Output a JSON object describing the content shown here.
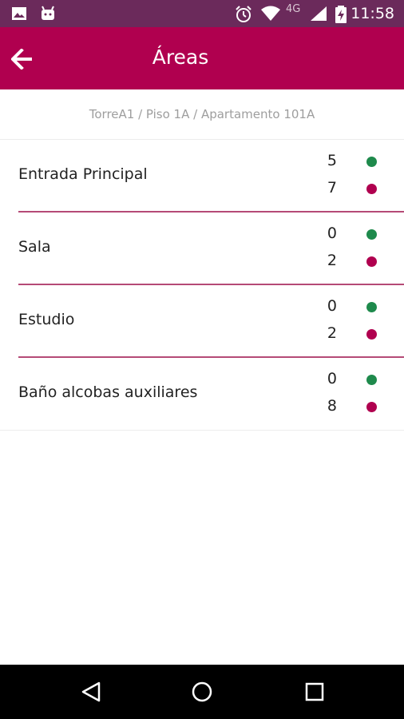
{
  "status_bar": {
    "time": "11:58",
    "network": "4G",
    "icons": [
      "image-icon",
      "android-icon",
      "alarm-icon",
      "wifi-icon",
      "signal-icon",
      "battery-charging-icon"
    ]
  },
  "app_bar": {
    "title": "Áreas",
    "back_icon": "arrow-left-icon"
  },
  "breadcrumb": "TorreA1 / Piso 1A / Apartamento 101A",
  "colors": {
    "primary": "#b0004f",
    "status_bar": "#6b2a5b",
    "green": "#1e8a4c",
    "magenta": "#b0004f"
  },
  "areas": [
    {
      "name": "Entrada Principal",
      "green_count": "5",
      "magenta_count": "7"
    },
    {
      "name": "Sala",
      "green_count": "0",
      "magenta_count": "2"
    },
    {
      "name": "Estudio",
      "green_count": "0",
      "magenta_count": "2"
    },
    {
      "name": "Baño alcobas auxiliares",
      "green_count": "0",
      "magenta_count": "8"
    }
  ],
  "nav_bar": {
    "buttons": [
      "back-triangle-icon",
      "home-circle-icon",
      "recents-square-icon"
    ]
  }
}
